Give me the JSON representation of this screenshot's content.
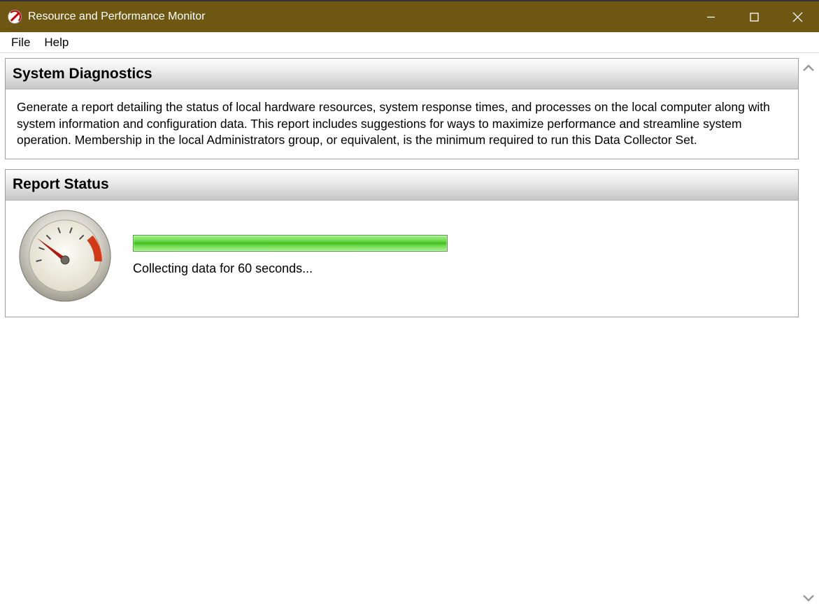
{
  "window": {
    "title": "Resource and Performance Monitor",
    "titlebar_color": "#6e5712"
  },
  "menu": {
    "file": "File",
    "help": "Help"
  },
  "panels": {
    "diagnostics": {
      "title": "System Diagnostics",
      "description": "Generate a report detailing the status of local hardware resources, system response times, and processes on the local computer along with system information and configuration data. This report includes suggestions for ways to maximize performance and streamline system operation. Membership in the local Administrators group, or equivalent, is the minimum required to run this Data Collector Set."
    },
    "report_status": {
      "title": "Report Status",
      "message": "Collecting data for 60 seconds...",
      "progress_color": "#3fbd1e",
      "icon": "gauge-icon"
    }
  }
}
